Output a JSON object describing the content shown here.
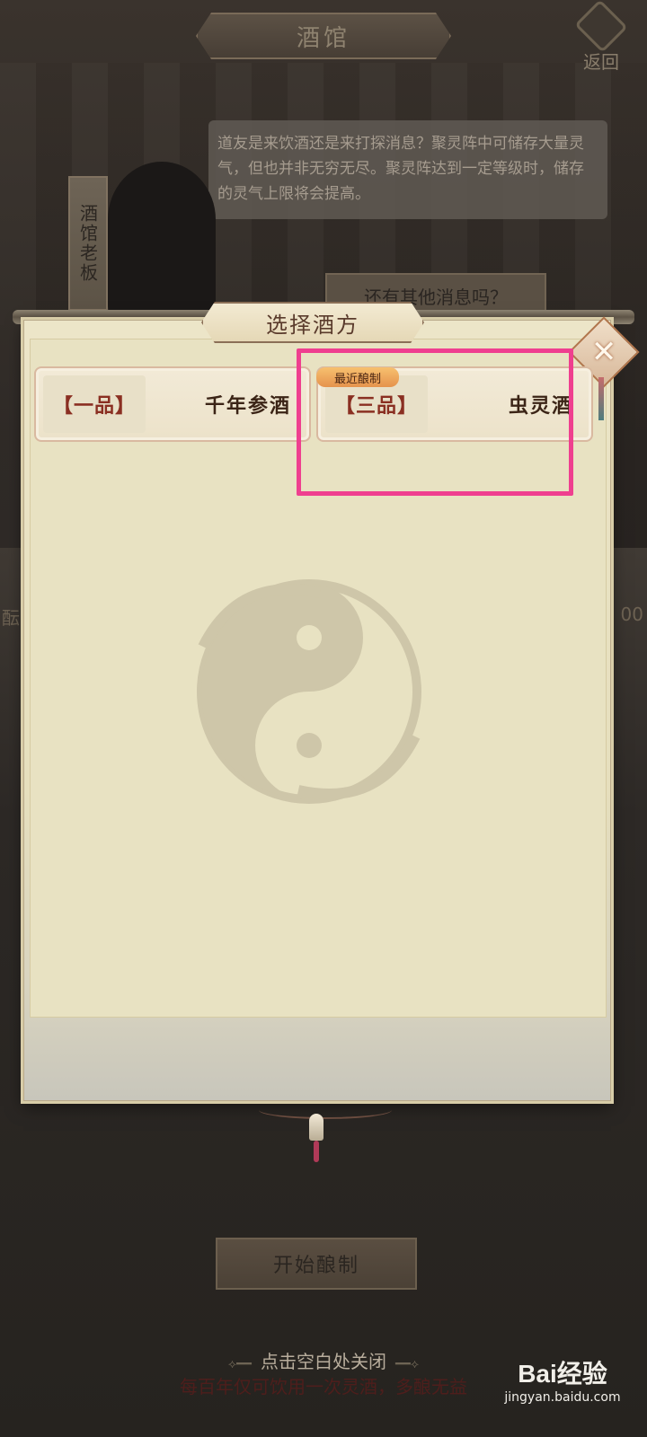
{
  "header": {
    "title": "酒馆",
    "back_label": "返回"
  },
  "npc": {
    "name": "酒馆老板",
    "dialog": "道友是来饮酒还是来打探消息？聚灵阵中可储存大量灵气，但也并非无穷无尽。聚灵阵达到一定等级时，储存的灵气上限将会提高。",
    "option": "还有其他消息吗？"
  },
  "modal": {
    "title": "选择酒方",
    "recipes": [
      {
        "grade": "【一品】",
        "name": "千年参酒"
      },
      {
        "grade": "【三品】",
        "name": "虫灵酒",
        "tag": "最近酿制"
      }
    ]
  },
  "side": {
    "left": "酝",
    "right": "00"
  },
  "footer": {
    "brew_button": "开始酿制",
    "close_hint": "点击空白处关闭",
    "note": "每百年仅可饮用一次灵酒，多酿无益",
    "watermark": "Bai经验",
    "watermark_url": "jingyan.baidu.com"
  },
  "colors": {
    "highlight": "#ef3f8f",
    "grade_text": "#8a2f22"
  }
}
